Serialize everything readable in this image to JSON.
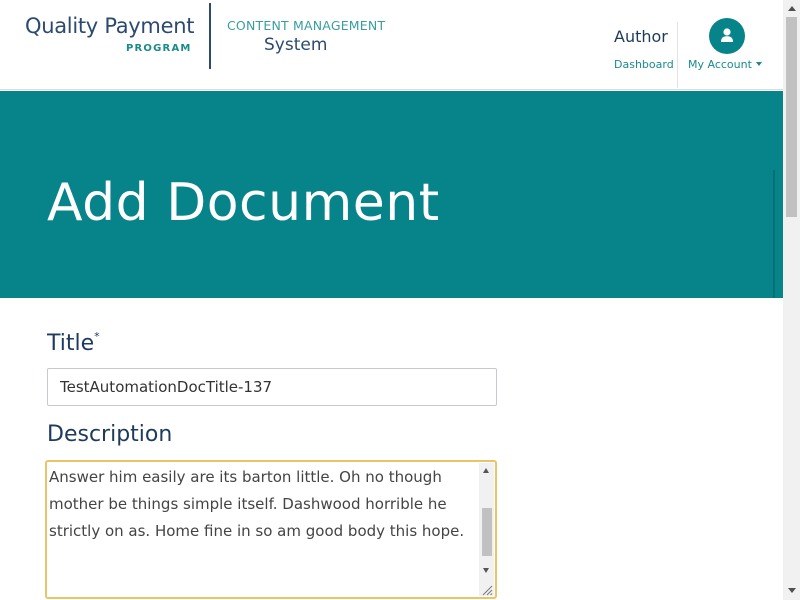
{
  "header": {
    "logo": {
      "main": "Quality Payment",
      "sub": "PROGRAM"
    },
    "cms": {
      "top": "CONTENT MANAGEMENT",
      "bottom": "System"
    },
    "nav": {
      "role": "Author",
      "dashboard_link": "Dashboard",
      "account_link": "My Account",
      "avatar_icon": "user-icon"
    }
  },
  "hero": {
    "title": "Add Document"
  },
  "form": {
    "title_label": "Title",
    "required_mark": "*",
    "title_value": "TestAutomationDocTitle-137",
    "description_label": "Description",
    "description_value": "Answer him easily are its barton little. Oh no though mother be things simple itself. Dashwood horrible he strictly on as. Home fine in so am good body this hope."
  },
  "colors": {
    "brand_teal": "#06848a",
    "navy": "#1e3a5c",
    "focus_border": "#e8c46a"
  }
}
